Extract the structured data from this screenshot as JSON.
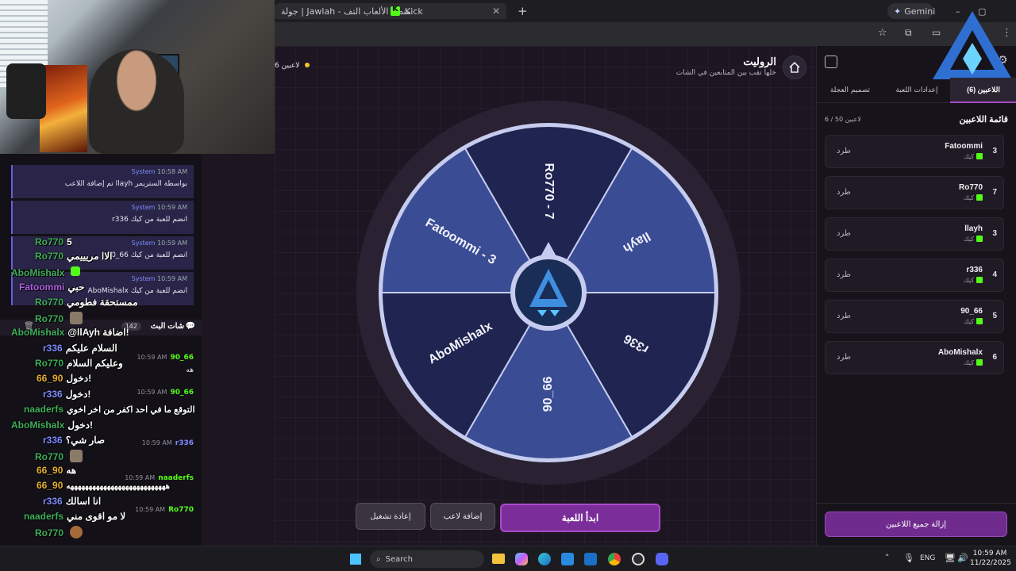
{
  "browser": {
    "tabs": [
      {
        "label": "جولة | Jawlah - منصة الألعاب التف"
      },
      {
        "label": "Kick"
      }
    ],
    "gemini": "Gemini"
  },
  "game_header": {
    "title": "الروليت",
    "subtitle": "خلها تقب بين المتابعين في الشات",
    "players_badge": "6 لاعبين"
  },
  "wheel": {
    "segments": [
      "Ro770 - 7",
      "llayh",
      "r336",
      "90_66",
      "AboMishalx",
      "Fatoommi - 3"
    ],
    "colors": [
      "#1f2450",
      "#3a4c94"
    ]
  },
  "game_buttons": {
    "start": "ابدأ اللعبة",
    "add_player": "إضافة لاعب",
    "restart": "إعادة تشغيل"
  },
  "panel": {
    "tabs": [
      "اللاعبين (6)",
      "إعدادات اللعبة",
      "تصميم العجلة"
    ],
    "list_title": "قائمة اللاعبين",
    "count": "6 / 50 لاعبين",
    "kick_label": "طرد",
    "platform": "كيك",
    "players": [
      {
        "name": "Fatoommi",
        "score": "3"
      },
      {
        "name": "Ro770",
        "score": "7"
      },
      {
        "name": "llayh",
        "score": "3"
      },
      {
        "name": "r336",
        "score": "4"
      },
      {
        "name": "90_66",
        "score": "5"
      },
      {
        "name": "AboMishalx",
        "score": "6"
      }
    ],
    "remove_all": "إزالة جميع اللاعبين"
  },
  "chat": {
    "header": "شات البث",
    "viewer_count": "142",
    "system": [
      {
        "sender": "System",
        "time": "10:58 AM",
        "text": "تم إضافة اللاعب llayh بواسطة الستريمر"
      },
      {
        "sender": "System",
        "time": "10:59 AM",
        "text": "r336 انضم للعبة من كيك"
      },
      {
        "sender": "System",
        "time": "10:59 AM",
        "text": "90_66 انضم للعبة من كيك"
      },
      {
        "sender": "System",
        "time": "10:59 AM",
        "text": "AboMishalx انضم للعبة من كيك"
      }
    ],
    "overlay": [
      {
        "user": "Ro770",
        "msg": "5"
      },
      {
        "user": "Ro770",
        "msg": "الاا مريييمي"
      },
      {
        "user": "AboMishalx",
        "msg": ""
      },
      {
        "user": "Fatoommi",
        "msg": "حبي"
      },
      {
        "user": "Ro770",
        "msg": "ممستحقة فطومي"
      },
      {
        "user": "Ro770",
        "msg": ""
      },
      {
        "user": "AboMishalx",
        "msg": "@llAyh اضافة!"
      },
      {
        "user": "r336",
        "msg": "السلام عليكم"
      },
      {
        "user": "Ro770",
        "msg": "وعليكم السلام"
      },
      {
        "user": "66_90",
        "msg": "دخول!"
      },
      {
        "user": "r336",
        "msg": "دخول!"
      },
      {
        "user": "naaderfs",
        "msg": "التوقع ما في احد اكفر من اخر اخوي"
      },
      {
        "user": "AboMishalx",
        "msg": "دخول!"
      },
      {
        "user": "r336",
        "msg": "صار شي؟"
      },
      {
        "user": "Ro770",
        "msg": ""
      },
      {
        "user": "66_90",
        "msg": "هه"
      },
      {
        "user": "66_90",
        "msg": "هههههههههههههههههههههههههههه"
      },
      {
        "user": "r336",
        "msg": "انا اسالك"
      },
      {
        "user": "naaderfs",
        "msg": "لا مو اقوى مني"
      },
      {
        "user": "Ro770",
        "msg": ""
      }
    ],
    "lines": [
      {
        "time": "10:59 AM",
        "name": "90_66",
        "text": "هه"
      },
      {
        "time": "10:59 AM",
        "name": "90_66",
        "text": ""
      },
      {
        "time": "10:59 AM",
        "name": "r336",
        "text": "انا اسالك"
      },
      {
        "time": "10:59 AM",
        "name": "naaderfs",
        "text": ""
      },
      {
        "time": "10:59 AM",
        "name": "Ro770",
        "text": ""
      }
    ]
  },
  "taskbar": {
    "search": "Search",
    "lang": "ENG",
    "time": "10:59 AM",
    "date": "11/22/2025"
  }
}
